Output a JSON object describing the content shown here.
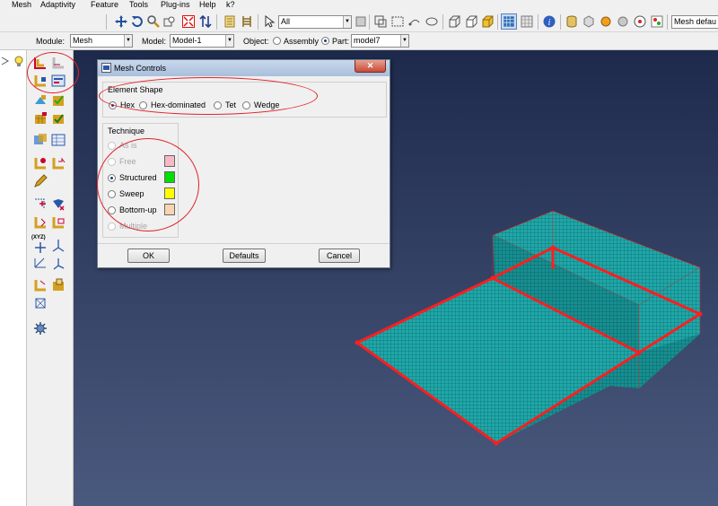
{
  "menubar": {
    "items": [
      "Mesh",
      "Adaptivity",
      "Feature",
      "Tools",
      "Plug-ins",
      "Help",
      "k?"
    ]
  },
  "toolbar": {
    "filter_value": "All",
    "mesh_default_label": "Mesh defau"
  },
  "context_bar": {
    "module_label": "Module:",
    "module_value": "Mesh",
    "model_label": "Model:",
    "model_value": "Model-1",
    "object_label": "Object:",
    "assembly_label": "Assembly",
    "part_label": "Part:",
    "part_value": "model7"
  },
  "dialog": {
    "title": "Mesh Controls",
    "element_shape": {
      "title": "Element Shape",
      "options": [
        "Hex",
        "Hex-dominated",
        "Tet",
        "Wedge"
      ],
      "selected": "Hex"
    },
    "technique": {
      "title": "Technique",
      "options": [
        "As is",
        "Free",
        "Structured",
        "Sweep",
        "Bottom-up",
        "Multiple"
      ],
      "selected": "Structured",
      "swatch_colors": {
        "free": "#f9b8c6",
        "structured": "#00e000",
        "sweep": "#ffff00",
        "bottom_up": "#f7d5b0"
      }
    },
    "buttons": {
      "ok": "OK",
      "defaults": "Defaults",
      "cancel": "Cancel"
    }
  },
  "colors": {
    "mesh_fill": "#1fa7a7",
    "highlight_edges": "#ff1e1e",
    "annotation": "#e0202a"
  }
}
